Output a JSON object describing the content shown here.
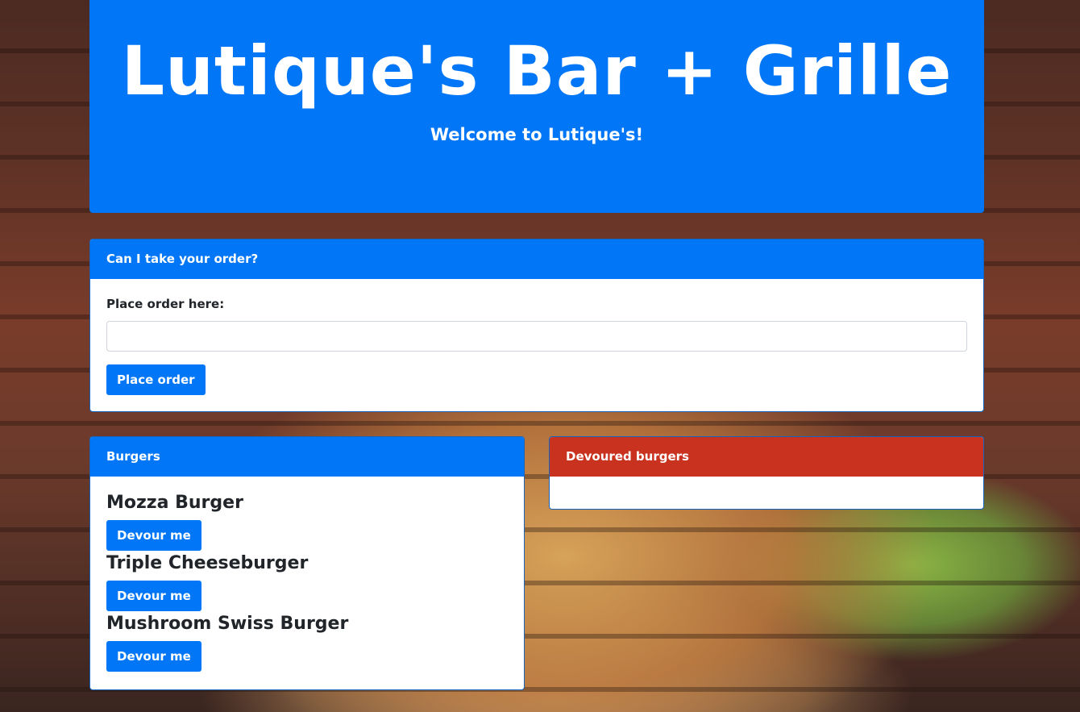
{
  "header": {
    "title": "Lutique's Bar + Grille",
    "subtitle": "Welcome to Lutique's!"
  },
  "order_panel": {
    "heading": "Can I take your order?",
    "field_label": "Place order here:",
    "input_value": "",
    "input_placeholder": "",
    "submit_label": "Place order"
  },
  "burgers_panel": {
    "heading": "Burgers",
    "items": [
      {
        "name": "Mozza Burger",
        "button_label": "Devour me"
      },
      {
        "name": "Triple Cheeseburger",
        "button_label": "Devour me"
      },
      {
        "name": "Mushroom Swiss Burger",
        "button_label": "Devour me"
      }
    ]
  },
  "devoured_panel": {
    "heading": "Devoured burgers",
    "items": []
  },
  "colors": {
    "primary": "#0176f6",
    "danger": "#c8321e",
    "text": "#212529"
  }
}
